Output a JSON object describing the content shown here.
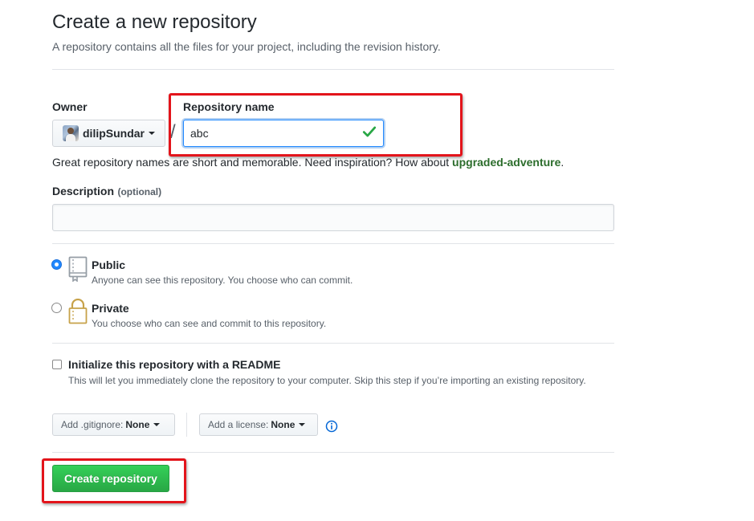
{
  "header": {
    "title": "Create a new repository",
    "subtitle": "A repository contains all the files for your project, including the revision history."
  },
  "owner": {
    "label": "Owner",
    "selected": "dilipSundar"
  },
  "separator": "/",
  "repo_name": {
    "label": "Repository name",
    "value": "abc",
    "valid": true
  },
  "hint": {
    "prefix": "Great repository names are short and memorable. Need inspiration? How about ",
    "suggestion": "upgraded-adventure",
    "suffix": "."
  },
  "description": {
    "label": "Description",
    "optional": "(optional)",
    "value": "",
    "placeholder": ""
  },
  "visibility": {
    "options": [
      {
        "title": "Public",
        "desc": "Anyone can see this repository. You choose who can commit.",
        "checked": true,
        "icon": "repo-book-icon"
      },
      {
        "title": "Private",
        "desc": "You choose who can see and commit to this repository.",
        "checked": false,
        "icon": "lock-icon"
      }
    ]
  },
  "readme": {
    "title": "Initialize this repository with a README",
    "desc": "This will let you immediately clone the repository to your computer. Skip this step if you’re importing an existing repository.",
    "checked": false
  },
  "gitignore": {
    "label": "Add .gitignore:",
    "value": "None"
  },
  "license": {
    "label": "Add a license:",
    "value": "None"
  },
  "submit": {
    "label": "Create repository"
  },
  "colors": {
    "primary_button": "#28a745",
    "focus_border": "#2188ff",
    "highlight_box": "#e3141b",
    "success_check": "#28a745"
  }
}
